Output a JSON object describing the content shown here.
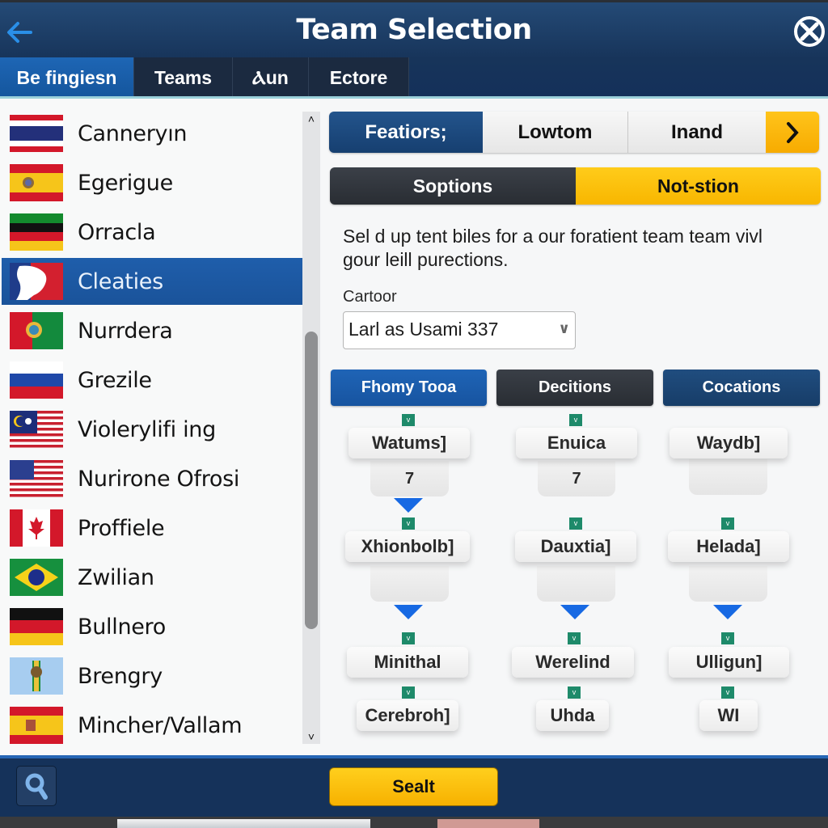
{
  "header": {
    "title": "Team Selection",
    "back_icon": "arrow-left-icon",
    "close_icon": "close-circle-icon"
  },
  "tabs": [
    {
      "label": "Be fingiesn",
      "active": true
    },
    {
      "label": "Teams",
      "active": false
    },
    {
      "label": "Ⲁun",
      "active": false
    },
    {
      "label": "Ectore",
      "active": false
    }
  ],
  "list": {
    "items": [
      {
        "label": "Canneryın",
        "flag": "thailand-like",
        "selected": false
      },
      {
        "label": "Egerigue",
        "flag": "spain-like",
        "selected": false
      },
      {
        "label": "Orracla",
        "flag": "green-black-red-yellow",
        "selected": false
      },
      {
        "label": "Cleaties",
        "flag": "blue-red-emblem",
        "selected": true
      },
      {
        "label": "Nurrdera",
        "flag": "portugal-like",
        "selected": false
      },
      {
        "label": "Grezile",
        "flag": "russia-like",
        "selected": false
      },
      {
        "label": "Violerylifi ing",
        "flag": "malaysia-like",
        "selected": false
      },
      {
        "label": "Nurirone Ofrosi",
        "flag": "usa-like",
        "selected": false
      },
      {
        "label": "Proffiele",
        "flag": "canada-like",
        "selected": false
      },
      {
        "label": "Zwilian",
        "flag": "brazil-like",
        "selected": false
      },
      {
        "label": "Bullnero",
        "flag": "germany-like",
        "selected": false
      },
      {
        "label": "Brengry",
        "flag": "lightblue-emblem",
        "selected": false
      },
      {
        "label": "Mincher/Vallam",
        "flag": "spain-like",
        "selected": false
      }
    ],
    "scroll_up_glyph": "˄",
    "scroll_down_glyph": "˅"
  },
  "segmented_primary": {
    "items": [
      "Featiors;",
      "Lowtom",
      "Inand"
    ],
    "next_glyph": "›"
  },
  "segmented_secondary": {
    "items": [
      "Soptions",
      "Not-stion"
    ]
  },
  "description": "Sel d up tent biles for a our foratient team team vivl gour leill purections.",
  "field": {
    "label": "Cartoor",
    "value": "Larl as Usami 337",
    "arrow": "∨"
  },
  "columns": [
    {
      "header": "Fhomy Tooa",
      "nodes": [
        {
          "label": "Watums]",
          "sub": "7"
        },
        {
          "label": "Xhionbolb]",
          "sub": ""
        },
        {
          "label": "Minithal"
        },
        {
          "label": "Cerebroh]"
        }
      ]
    },
    {
      "header": "Decitions",
      "nodes": [
        {
          "label": "Enuica",
          "sub": "7"
        },
        {
          "label": "Dauxtia]",
          "sub": ""
        },
        {
          "label": "Werelind"
        },
        {
          "label": "Uhda"
        }
      ]
    },
    {
      "header": "Cocations",
      "nodes": [
        {
          "label": "Waydb]",
          "sub": ""
        },
        {
          "label": "Helada]",
          "sub": ""
        },
        {
          "label": "Ulligun]"
        },
        {
          "label": "WI"
        }
      ]
    }
  ],
  "badge_glyph": "v",
  "footer": {
    "search_icon": "search-icon",
    "primary_label": "Sealt"
  },
  "colors": {
    "header_bg": "#17345a",
    "accent_blue": "#1e66b5",
    "accent_yellow": "#ffc41b",
    "dark": "#2e3238",
    "badge_green": "#1e8a6a",
    "arrow_blue": "#1769e3"
  }
}
